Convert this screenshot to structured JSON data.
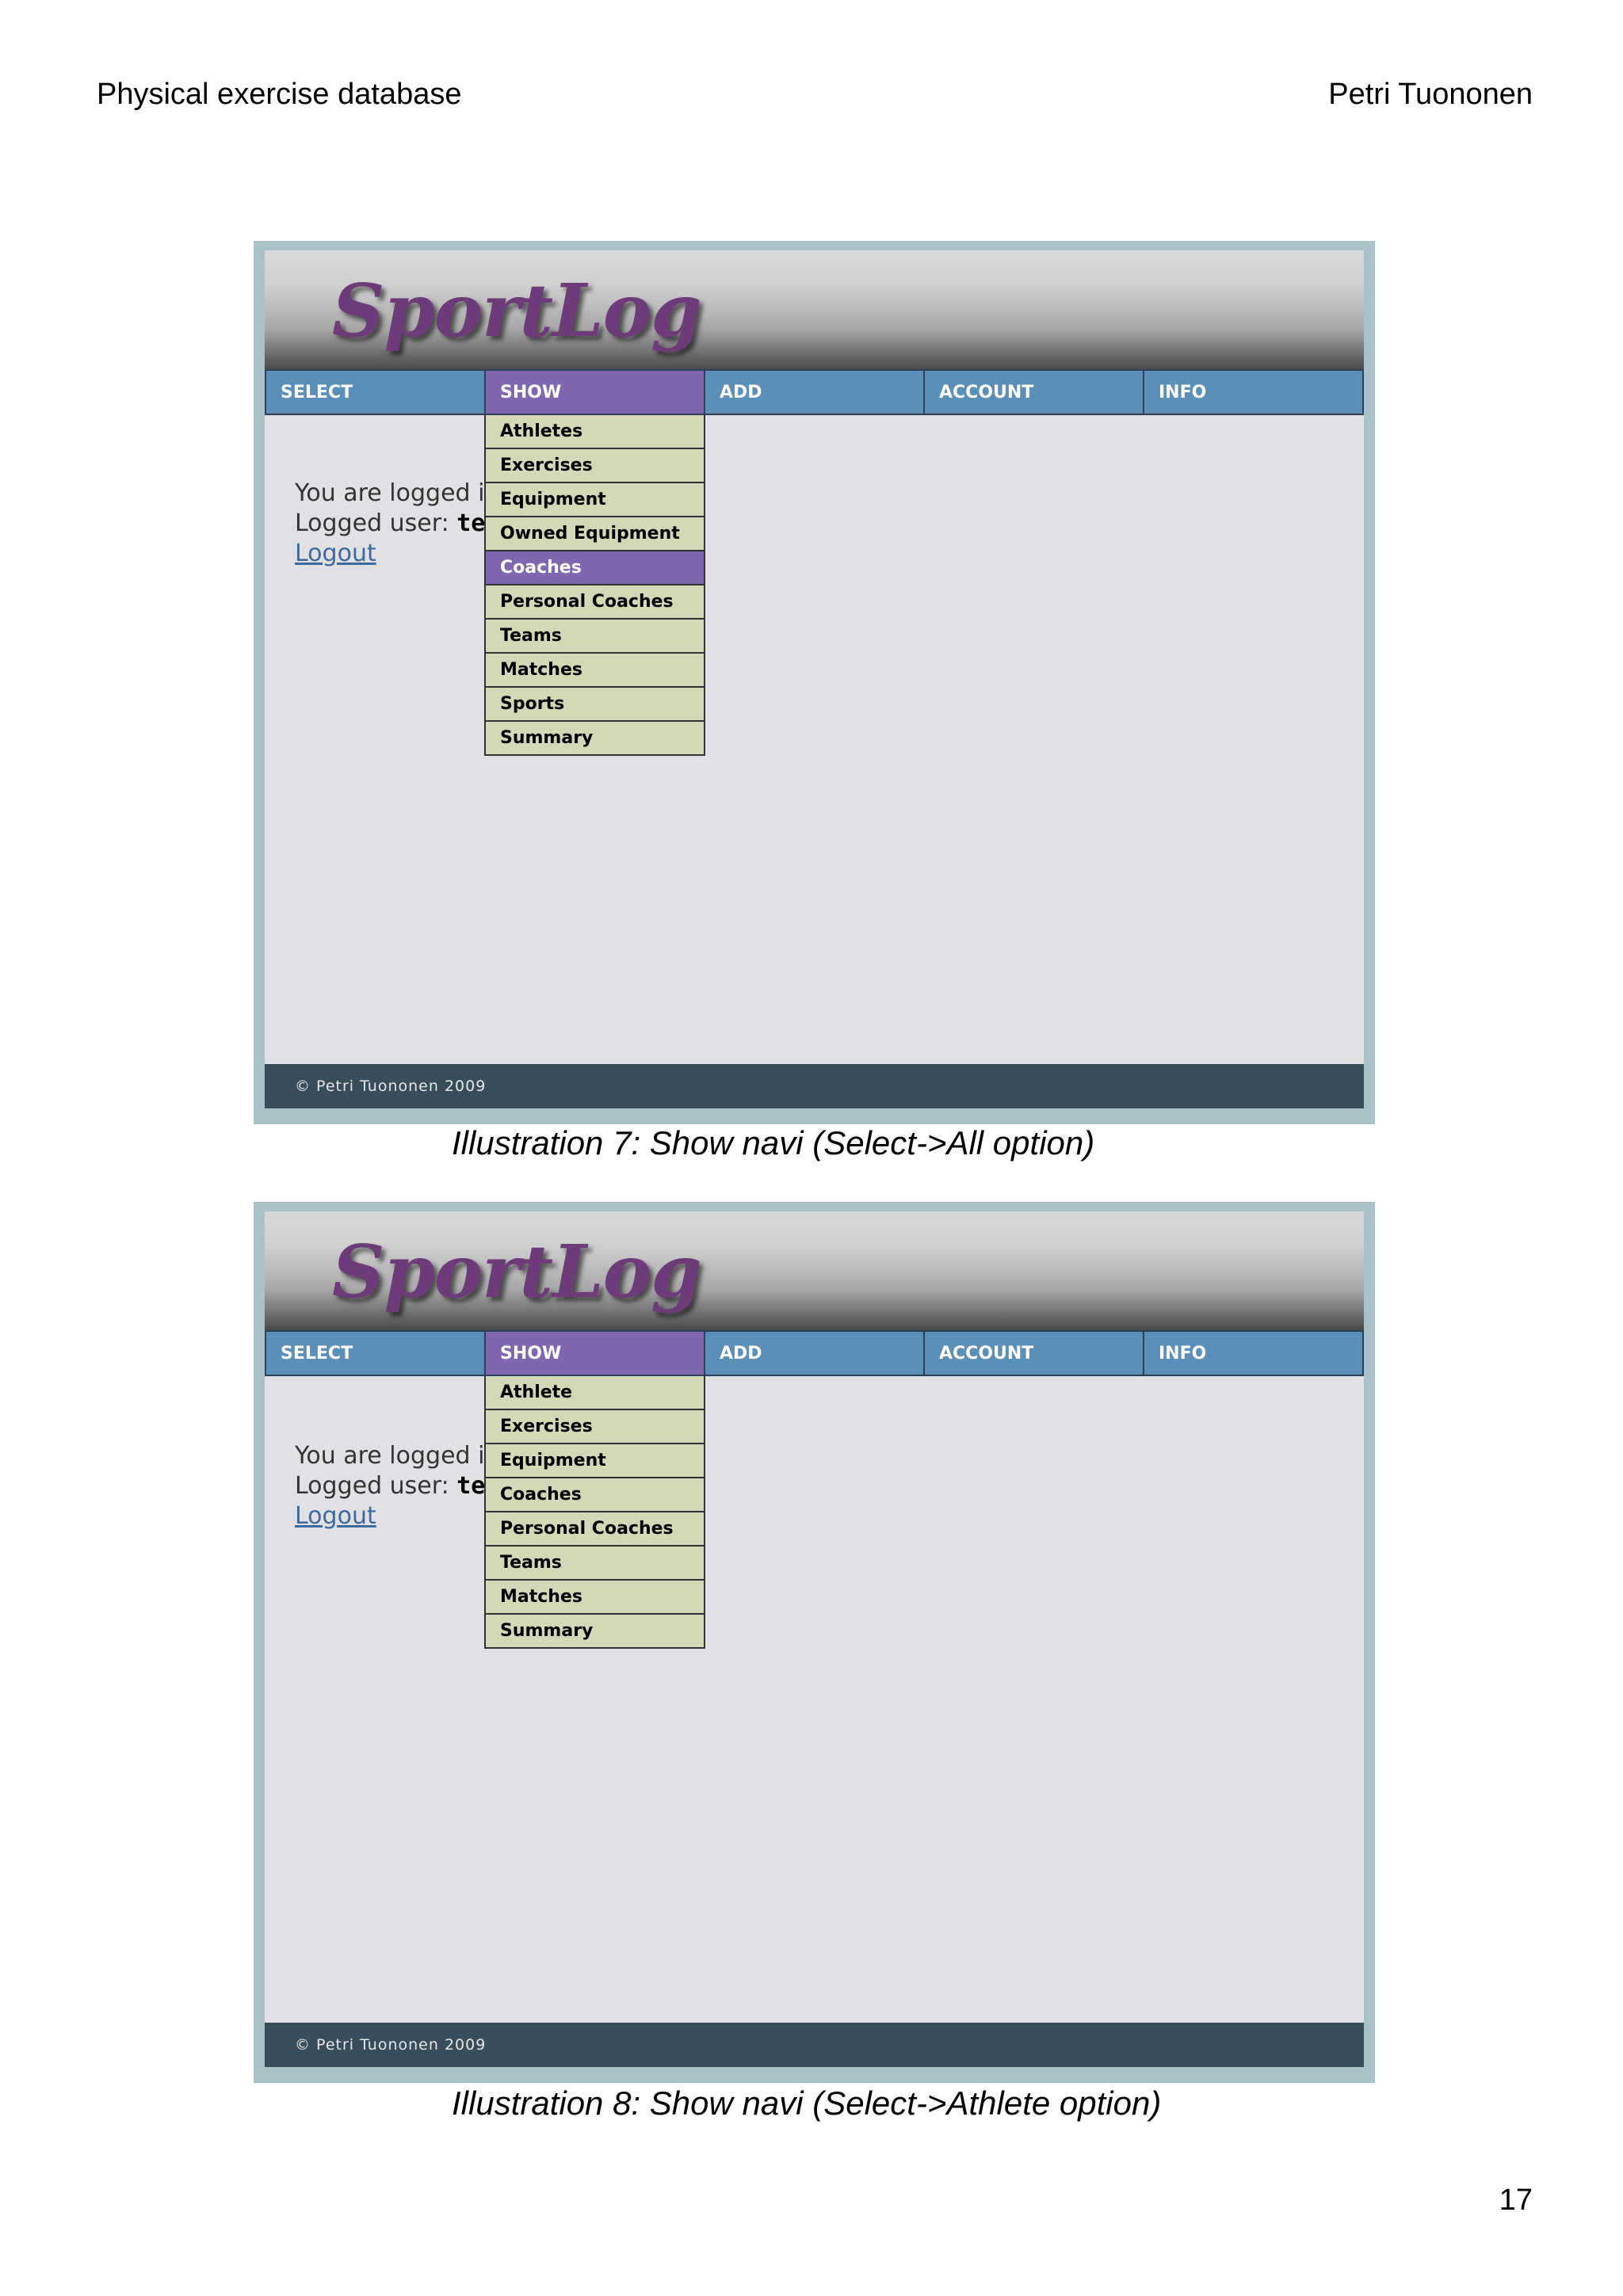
{
  "header": {
    "left": "Physical exercise database",
    "right": "Petri Tuononen"
  },
  "page_number": "17",
  "screenshots": [
    {
      "logo": "SportLog",
      "nav": [
        "SELECT",
        "SHOW",
        "ADD",
        "ACCOUNT",
        "INFO"
      ],
      "active_nav": "SHOW",
      "dropdown": [
        "Athletes",
        "Exercises",
        "Equipment",
        "Owned Equipment",
        "Coaches",
        "Personal Coaches",
        "Teams",
        "Matches",
        "Sports",
        "Summary"
      ],
      "highlighted_item": "Coaches",
      "login": {
        "line1": "You are logged in",
        "user_label": "Logged user:",
        "user": "test",
        "logout": "Logout"
      },
      "footer": "© Petri Tuononen 2009",
      "caption": "Illustration 7: Show navi (Select->All option)"
    },
    {
      "logo": "SportLog",
      "nav": [
        "SELECT",
        "SHOW",
        "ADD",
        "ACCOUNT",
        "INFO"
      ],
      "active_nav": "SHOW",
      "dropdown": [
        "Athlete",
        "Exercises",
        "Equipment",
        "Coaches",
        "Personal Coaches",
        "Teams",
        "Matches",
        "Summary"
      ],
      "highlighted_item": "",
      "login": {
        "line1": "You are logged in",
        "user_label": "Logged user:",
        "user": "test",
        "logout": "Logout"
      },
      "footer": "© Petri Tuononen 2009",
      "caption": "Illustration 8: Show navi (Select->Athlete option)"
    }
  ],
  "colors": {
    "nav_bg": "#5b8fb8",
    "nav_active": "#7f67b0",
    "dropdown_bg": "#d3d8b6",
    "footer_bg": "#374d5c",
    "logo": "#6d3c78",
    "frame": "#a9c2c8"
  }
}
